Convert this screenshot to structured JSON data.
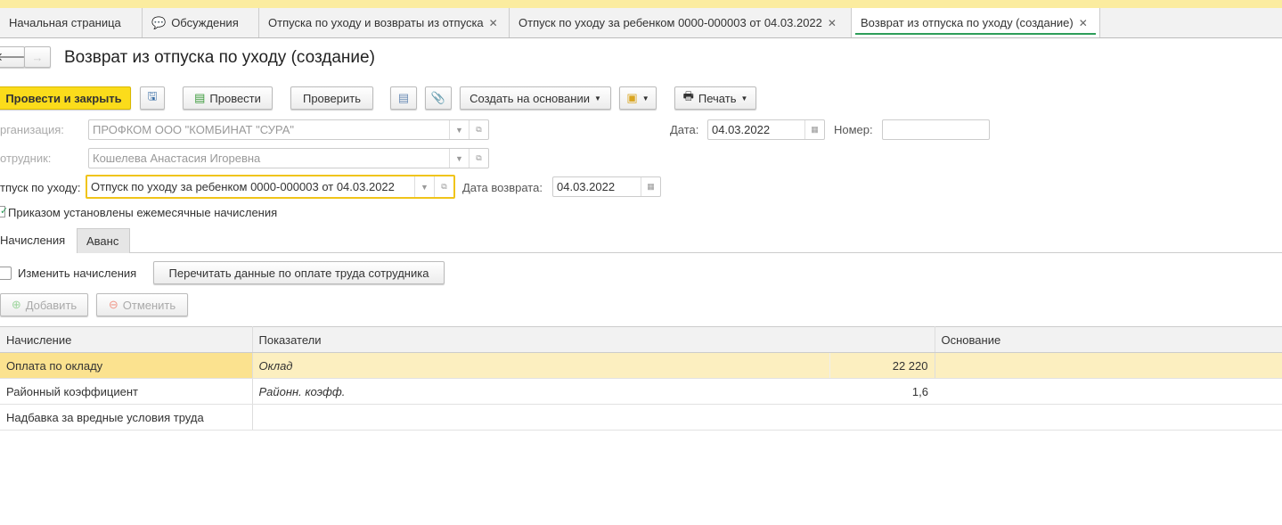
{
  "tabs": [
    {
      "label": "Начальная страница"
    },
    {
      "label": "Обсуждения"
    },
    {
      "label": "Отпуска по уходу и возвраты из отпуска"
    },
    {
      "label": "Отпуск по уходу за ребенком 0000-000003 от 04.03.2022"
    },
    {
      "label": "Возврат из отпуска по уходу (создание)"
    }
  ],
  "title": "Возврат из отпуска по уходу (создание)",
  "toolbar": {
    "post_close": "Провести и закрыть",
    "post": "Провести",
    "check": "Проверить",
    "create_based": "Создать на основании",
    "print": "Печать"
  },
  "form": {
    "org_label": "рганизация:",
    "org_value": "ПРОФКОМ ООО \"КОМБИНАТ \"СУРА\"",
    "emp_label": "отрудник:",
    "emp_value": "Кошелева Анастасия Игоревна",
    "leave_label": "тпуск по уходу:",
    "leave_value": "Отпуск по уходу за ребенком 0000-000003 от 04.03.2022",
    "return_label": "Дата возврата:",
    "return_value": "04.03.2022",
    "date_label": "Дата:",
    "date_value": "04.03.2022",
    "number_label": "Номер:",
    "number_value": "",
    "monthly_label": "Приказом установлены ежемесячные начисления"
  },
  "subtabs": {
    "accruals": "Начисления",
    "advance": "Аванс"
  },
  "accruals": {
    "change_label": "Изменить начисления",
    "reread": "Перечитать данные по оплате труда сотрудника",
    "add": "Добавить",
    "cancel": "Отменить"
  },
  "table": {
    "headers": [
      "Начисление",
      "Показатели",
      "Основание"
    ],
    "rows": [
      {
        "name": "Оплата по окладу",
        "ind": "Оклад",
        "val": "22 220",
        "basis": ""
      },
      {
        "name": "Районный коэффициент",
        "ind": "Районн. коэфф.",
        "val": "1,6",
        "basis": ""
      },
      {
        "name": "Надбавка за вредные условия труда",
        "ind": "",
        "val": "",
        "basis": ""
      }
    ]
  }
}
